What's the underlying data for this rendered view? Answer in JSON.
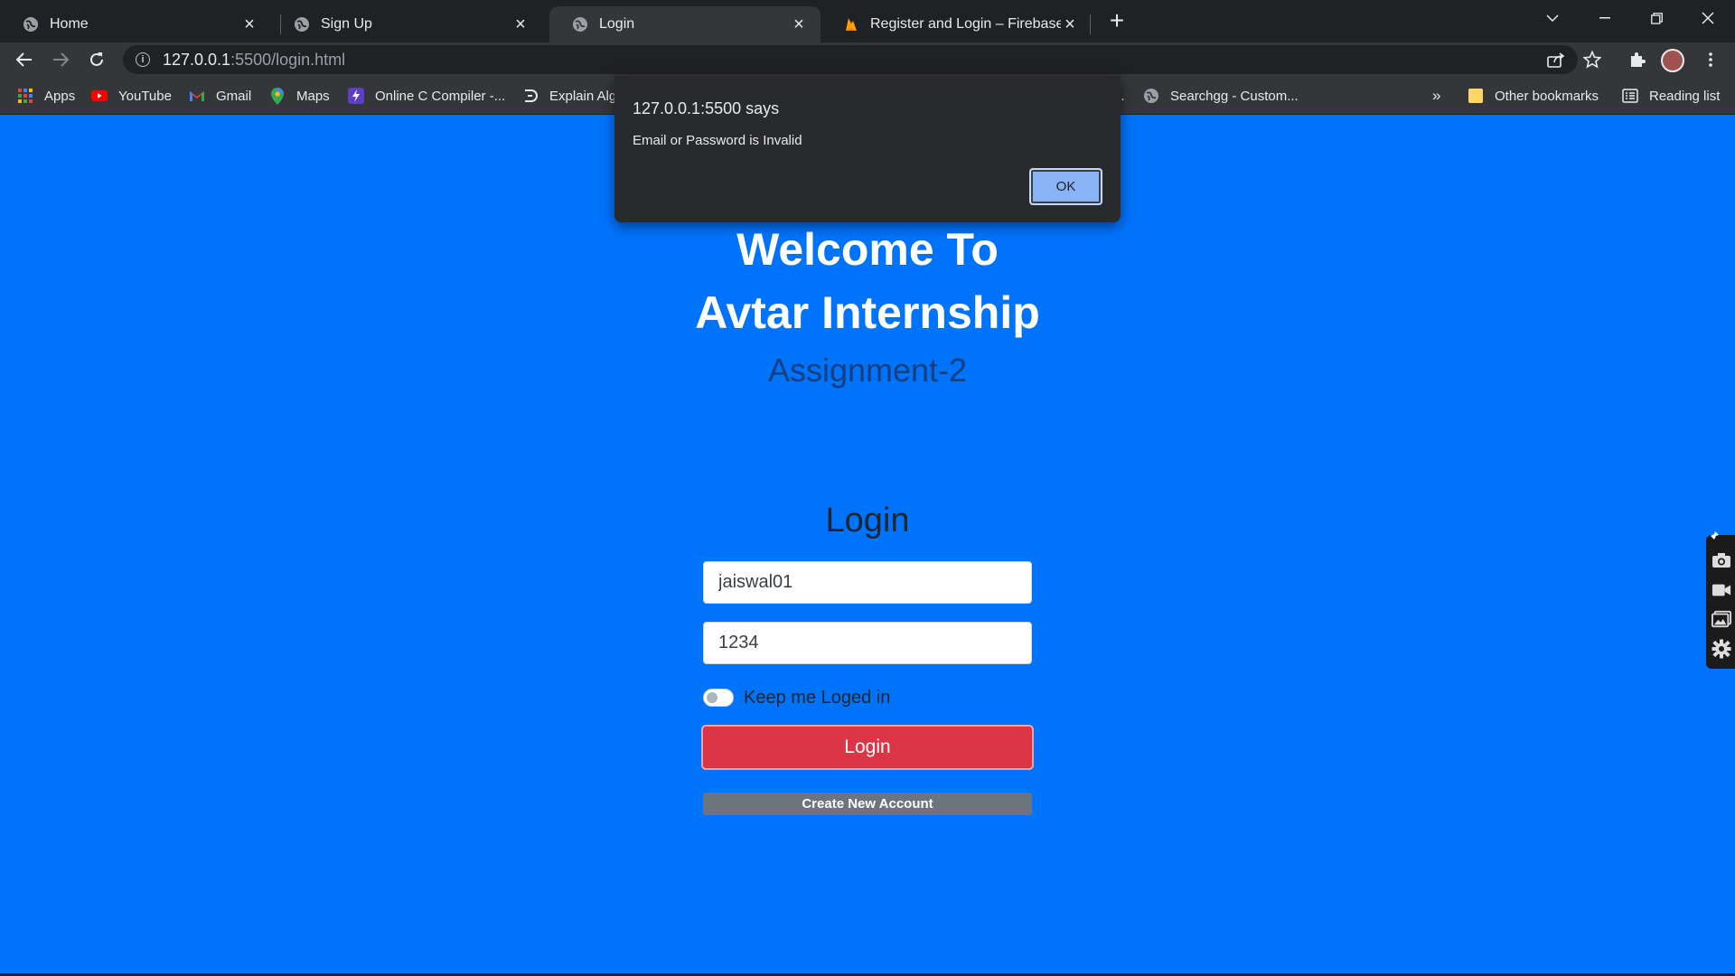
{
  "browser": {
    "tabs": [
      {
        "title": "Home",
        "icon": "globe-icon"
      },
      {
        "title": "Sign Up",
        "icon": "globe-icon"
      },
      {
        "title": "Login",
        "icon": "globe-icon"
      },
      {
        "title": "Register and Login – Firebase con",
        "icon": "firebase-icon"
      }
    ],
    "url_host": "127.0.0.1",
    "url_path": ":5500/login.html",
    "bookmarks": [
      {
        "label": "Apps",
        "icon": "apps-grid-icon"
      },
      {
        "label": "YouTube",
        "icon": "youtube-icon"
      },
      {
        "label": "Gmail",
        "icon": "gmail-icon"
      },
      {
        "label": "Maps",
        "icon": "maps-icon"
      },
      {
        "label": "Online C Compiler -...",
        "icon": "compiler-icon"
      },
      {
        "label": "Explain Alg",
        "icon": "explain-icon"
      },
      {
        "label": "...",
        "icon": ""
      },
      {
        "label": "Searchgg - Custom...",
        "icon": "globe-icon"
      },
      {
        "label": "»",
        "icon": ""
      },
      {
        "label": "Other bookmarks",
        "icon": "folder-icon"
      },
      {
        "label": "Reading list",
        "icon": "reading-list-icon"
      }
    ]
  },
  "page": {
    "heading_line1": "Welcome To",
    "heading_line2": "Avtar Internship",
    "subtitle": "Assignment-2",
    "login_title": "Login",
    "username_value": "jaiswal01",
    "password_value": "1234",
    "keep_logged_label": "Keep me Loged in",
    "keep_logged_checked": false,
    "login_button": "Login",
    "create_account_button": "Create New Account",
    "background_color": "#0073fb",
    "login_button_color": "#dc3545",
    "create_button_color": "#6c757d"
  },
  "dialog": {
    "title": "127.0.0.1:5500 says",
    "message": "Email or Password is Invalid",
    "ok_label": "OK"
  }
}
